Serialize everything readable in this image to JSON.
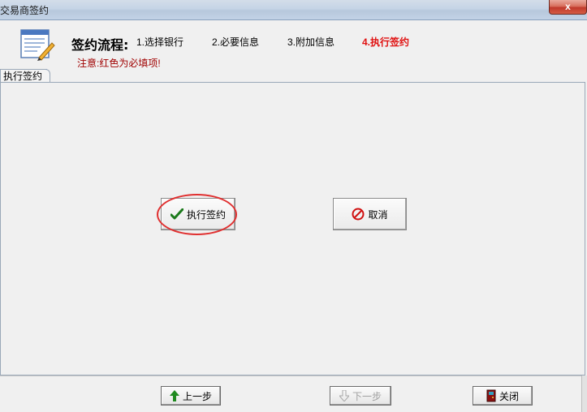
{
  "window": {
    "title": "交易商签约",
    "close_label": "x"
  },
  "header": {
    "flow_label": "签约流程:",
    "steps": [
      {
        "label": "1.选择银行",
        "active": false
      },
      {
        "label": "2.必要信息",
        "active": false
      },
      {
        "label": "3.附加信息",
        "active": false
      },
      {
        "label": "4.执行签约",
        "active": true
      }
    ],
    "note": "注意:红色为必填项!"
  },
  "tab": {
    "label": "执行签约"
  },
  "actions": {
    "execute_label": "执行签约",
    "cancel_label": "取消"
  },
  "footer": {
    "prev_label": "上一步",
    "next_label": "下一步",
    "close_label": "关闭"
  },
  "colors": {
    "active_step": "#e01010",
    "note": "#a00000",
    "highlight_ring": "#e03030",
    "check_icon": "#1b7a1b",
    "forbid_icon": "#d01010",
    "arrow_up": "#1f8a1f"
  },
  "icons": [
    "wizard-form-icon",
    "checkmark-icon",
    "no-entry-icon",
    "arrow-up-icon",
    "arrow-down-icon",
    "exit-door-icon"
  ]
}
